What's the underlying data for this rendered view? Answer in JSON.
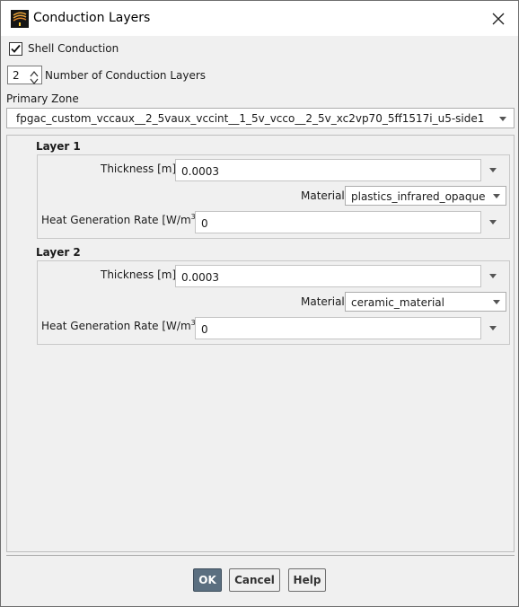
{
  "window": {
    "title": "Conduction Layers"
  },
  "shell_conduction": {
    "label": "Shell Conduction",
    "checked": true
  },
  "layers_count": {
    "value": "2",
    "label": "Number of Conduction Layers"
  },
  "primary_zone": {
    "label": "Primary Zone",
    "value": "fpgac_custom_vccaux__2_5vaux_vccint__1_5v_vcco__2_5v_xc2vp70_5ff1517i_u5-side1"
  },
  "layers": [
    {
      "title": "Layer  1",
      "thickness_label": "Thickness [m]",
      "thickness_value": "0.0003",
      "material_label": "Material",
      "material_value": "plastics_infrared_opaque",
      "heat_label": "Heat Generation Rate [W/m",
      "heat_sup": "3",
      "heat_close": "]",
      "heat_value": "0"
    },
    {
      "title": "Layer  2",
      "thickness_label": "Thickness [m]",
      "thickness_value": "0.0003",
      "material_label": "Material",
      "material_value": "ceramic_material",
      "heat_label": "Heat Generation Rate [W/m",
      "heat_sup": "3",
      "heat_close": "]",
      "heat_value": "0"
    }
  ],
  "buttons": {
    "ok": "OK",
    "cancel": "Cancel",
    "help": "Help"
  }
}
